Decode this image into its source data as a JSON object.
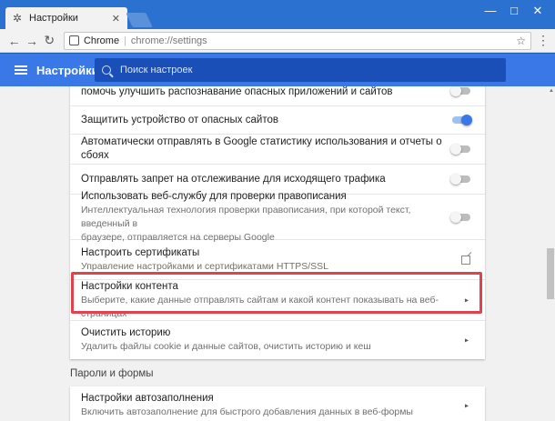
{
  "window": {
    "tab_title": "Настройки",
    "tab_close": "✕",
    "controls": {
      "minimize": "—",
      "maximize": "□",
      "close": "✕"
    }
  },
  "toolbar": {
    "back": "←",
    "forward": "→",
    "reload": "↻",
    "omnibox_label": "Chrome",
    "omnibox_sep": "|",
    "url": "chrome://settings",
    "star": "☆",
    "menu": "⋮"
  },
  "header": {
    "title": "Настройки",
    "search_placeholder": "Поиск настроек"
  },
  "privacy_rows": [
    {
      "title": "помочь улучшить распознавание опасных приложений и сайтов",
      "control": "toggle",
      "on": false
    },
    {
      "title": "Защитить устройство от опасных сайтов",
      "control": "toggle",
      "on": true
    },
    {
      "title": "Автоматически отправлять в Google статистику использования и отчеты о сбоях",
      "control": "toggle",
      "on": false
    },
    {
      "title": "Отправлять запрет на отслеживание для исходящего трафика",
      "control": "toggle",
      "on": false
    },
    {
      "title": "Использовать веб-службу для проверки правописания",
      "subtitle_1": "Интеллектуальная технология проверки правописания, при которой текст, введенный в",
      "subtitle_2": "браузере, отправляется на серверы Google",
      "control": "toggle",
      "on": false
    },
    {
      "title": "Настроить сертификаты",
      "subtitle_1": "Управление настройками и сертификатами HTTPS/SSL",
      "control": "external"
    },
    {
      "title": "Настройки контента",
      "subtitle_1": "Выберите, какие данные отправлять сайтам и какой контент показывать на веб-страницах",
      "control": "arrow"
    },
    {
      "title": "Очистить историю",
      "subtitle_1": "Удалить файлы cookie и данные сайтов, очистить историю и кеш",
      "control": "arrow"
    }
  ],
  "passwords_section": {
    "title": "Пароли и формы",
    "rows": [
      {
        "title": "Настройки автозаполнения",
        "subtitle_1": "Включить автозаполнение для быстрого добавления данных в веб-формы",
        "control": "arrow"
      }
    ]
  },
  "icons": {
    "arrow": "▸",
    "gear": "✲"
  },
  "colors": {
    "accent": "#3b78e7",
    "highlight": "#e0434d"
  }
}
